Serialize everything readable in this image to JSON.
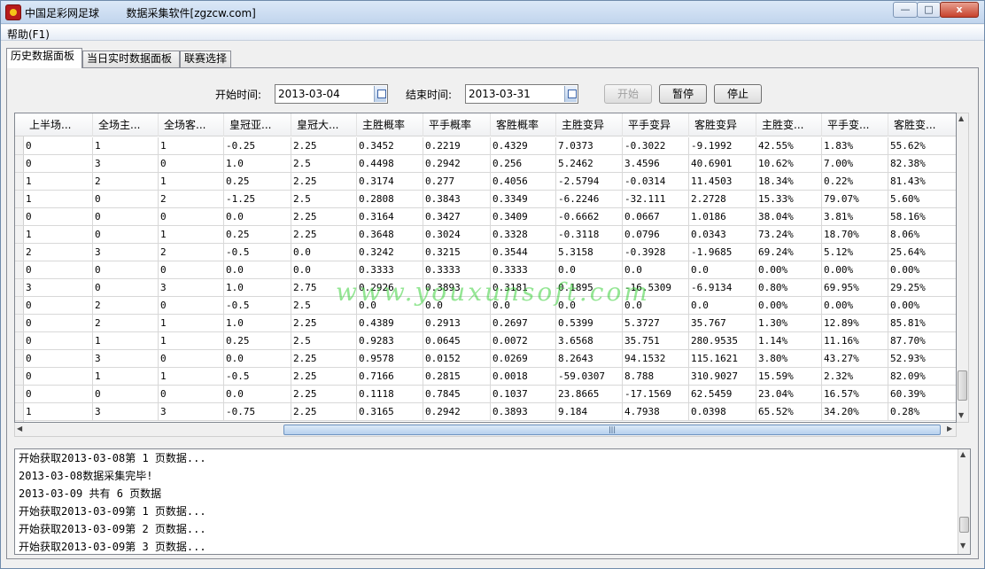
{
  "window": {
    "title": "中国足彩网足球        数据采集软件[zgzcw.com]",
    "min_label": "—",
    "max_label": "□",
    "close_label": "x"
  },
  "menu": {
    "help": "帮助(F1)"
  },
  "tabs": [
    "历史数据面板",
    "当日实时数据面板",
    "联赛选择"
  ],
  "controls": {
    "start_label": "开始时间:",
    "start_date": "2013-03-04",
    "end_label": "结束时间:",
    "end_date": "2013-03-31",
    "start_button": "开始",
    "pause_button": "暂停",
    "stop_button": "停止"
  },
  "grid": {
    "columns": [
      "上半场...",
      "全场主...",
      "全场客...",
      "皇冠亚...",
      "皇冠大...",
      "主胜概率",
      "平手概率",
      "客胜概率",
      "主胜变异",
      "平手变异",
      "客胜变异",
      "主胜变...",
      "平手变...",
      "客胜变..."
    ],
    "rows": [
      [
        "0",
        "1",
        "1",
        "-0.25",
        "2.25",
        "0.3452",
        "0.2219",
        "0.4329",
        "7.0373",
        "-0.3022",
        "-9.1992",
        "42.55%",
        "1.83%",
        "55.62%"
      ],
      [
        "0",
        "3",
        "0",
        "1.0",
        "2.5",
        "0.4498",
        "0.2942",
        "0.256",
        "5.2462",
        "3.4596",
        "40.6901",
        "10.62%",
        "7.00%",
        "82.38%"
      ],
      [
        "1",
        "2",
        "1",
        "0.25",
        "2.25",
        "0.3174",
        "0.277",
        "0.4056",
        "-2.5794",
        "-0.0314",
        "11.4503",
        "18.34%",
        "0.22%",
        "81.43%"
      ],
      [
        "1",
        "0",
        "2",
        "-1.25",
        "2.5",
        "0.2808",
        "0.3843",
        "0.3349",
        "-6.2246",
        "-32.111",
        "2.2728",
        "15.33%",
        "79.07%",
        "5.60%"
      ],
      [
        "0",
        "0",
        "0",
        "0.0",
        "2.25",
        "0.3164",
        "0.3427",
        "0.3409",
        "-0.6662",
        "0.0667",
        "1.0186",
        "38.04%",
        "3.81%",
        "58.16%"
      ],
      [
        "1",
        "0",
        "1",
        "0.25",
        "2.25",
        "0.3648",
        "0.3024",
        "0.3328",
        "-0.3118",
        "0.0796",
        "0.0343",
        "73.24%",
        "18.70%",
        "8.06%"
      ],
      [
        "2",
        "3",
        "2",
        "-0.5",
        "0.0",
        "0.3242",
        "0.3215",
        "0.3544",
        "5.3158",
        "-0.3928",
        "-1.9685",
        "69.24%",
        "5.12%",
        "25.64%"
      ],
      [
        "0",
        "0",
        "0",
        "0.0",
        "0.0",
        "0.3333",
        "0.3333",
        "0.3333",
        "0.0",
        "0.0",
        "0.0",
        "0.00%",
        "0.00%",
        "0.00%"
      ],
      [
        "3",
        "0",
        "3",
        "1.0",
        "2.75",
        "0.2926",
        "0.3893",
        "0.3181",
        "0.1895",
        "-16.5309",
        "-6.9134",
        "0.80%",
        "69.95%",
        "29.25%"
      ],
      [
        "0",
        "2",
        "0",
        "-0.5",
        "2.5",
        "0.0",
        "0.0",
        "0.0",
        "0.0",
        "0.0",
        "0.0",
        "0.00%",
        "0.00%",
        "0.00%"
      ],
      [
        "0",
        "2",
        "1",
        "1.0",
        "2.25",
        "0.4389",
        "0.2913",
        "0.2697",
        "0.5399",
        "5.3727",
        "35.767",
        "1.30%",
        "12.89%",
        "85.81%"
      ],
      [
        "0",
        "1",
        "1",
        "0.25",
        "2.5",
        "0.9283",
        "0.0645",
        "0.0072",
        "3.6568",
        "35.751",
        "280.9535",
        "1.14%",
        "11.16%",
        "87.70%"
      ],
      [
        "0",
        "3",
        "0",
        "0.0",
        "2.25",
        "0.9578",
        "0.0152",
        "0.0269",
        "8.2643",
        "94.1532",
        "115.1621",
        "3.80%",
        "43.27%",
        "52.93%"
      ],
      [
        "0",
        "1",
        "1",
        "-0.5",
        "2.25",
        "0.7166",
        "0.2815",
        "0.0018",
        "-59.0307",
        "8.788",
        "310.9027",
        "15.59%",
        "2.32%",
        "82.09%"
      ],
      [
        "0",
        "0",
        "0",
        "0.0",
        "2.25",
        "0.1118",
        "0.7845",
        "0.1037",
        "23.8665",
        "-17.1569",
        "62.5459",
        "23.04%",
        "16.57%",
        "60.39%"
      ],
      [
        "1",
        "3",
        "3",
        "-0.75",
        "2.25",
        "0.3165",
        "0.2942",
        "0.3893",
        "9.184",
        "4.7938",
        "0.0398",
        "65.52%",
        "34.20%",
        "0.28%"
      ]
    ]
  },
  "watermark": "www.youxunsoft.com",
  "log": [
    "开始获取2013-03-08第 1 页数据...",
    "2013-03-08数据采集完毕!",
    "2013-03-09 共有 6 页数据",
    "开始获取2013-03-09第 1 页数据...",
    "开始获取2013-03-09第 2 页数据...",
    "开始获取2013-03-09第 3 页数据..."
  ]
}
